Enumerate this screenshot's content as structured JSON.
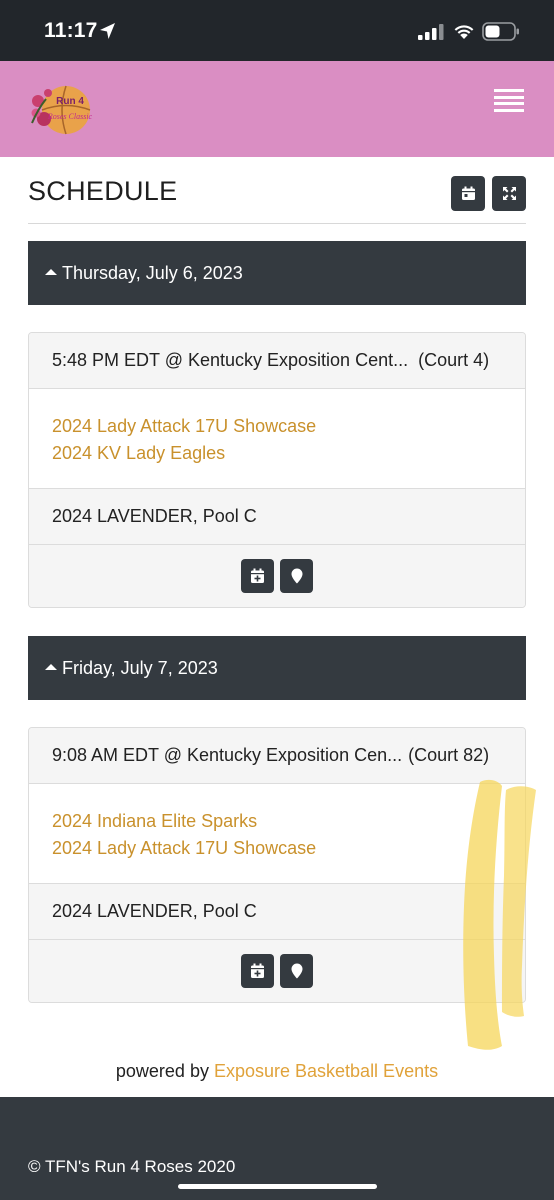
{
  "status_bar": {
    "time": "11:17",
    "icons": [
      "location-arrow-icon",
      "cellular-signal-icon",
      "wifi-icon",
      "battery-icon"
    ]
  },
  "header": {
    "logo_text": [
      "Run 4",
      "Roses Classic"
    ],
    "menu_icon": "hamburger-menu-icon",
    "background_color": "#da8ec3"
  },
  "schedule": {
    "title": "SCHEDULE",
    "toolbar_icons": [
      "calendar-icon",
      "expand-icon"
    ]
  },
  "days": [
    {
      "label": "Thursday, July 6, 2023",
      "games": [
        {
          "time_location": "5:48 PM EDT @ Kentucky Exposition Cent...",
          "court": "(Court 4)",
          "teams": [
            "2024 Lady Attack 17U Showcase",
            "2024 KV Lady Eagles"
          ],
          "pool": "2024 LAVENDER, Pool C",
          "actions": [
            "add-to-calendar-icon",
            "map-marker-icon"
          ]
        }
      ]
    },
    {
      "label": "Friday, July 7, 2023",
      "games": [
        {
          "time_location": "9:08 AM EDT @ Kentucky Exposition Cen...",
          "court": "(Court 82)",
          "teams": [
            "2024 Indiana Elite Sparks",
            "2024 Lady Attack 17U Showcase"
          ],
          "pool": "2024 LAVENDER, Pool C",
          "actions": [
            "add-to-calendar-icon",
            "map-marker-icon"
          ]
        }
      ]
    }
  ],
  "powered_by": {
    "prefix": "powered by",
    "link": "Exposure Basketball Events"
  },
  "footer": {
    "copyright": "© TFN's Run 4 Roses 2020"
  },
  "colors": {
    "dark": "#343a40",
    "team_link": "#c9912c",
    "powered_link": "#e0a23a",
    "highlighter": "#f6d65a"
  }
}
